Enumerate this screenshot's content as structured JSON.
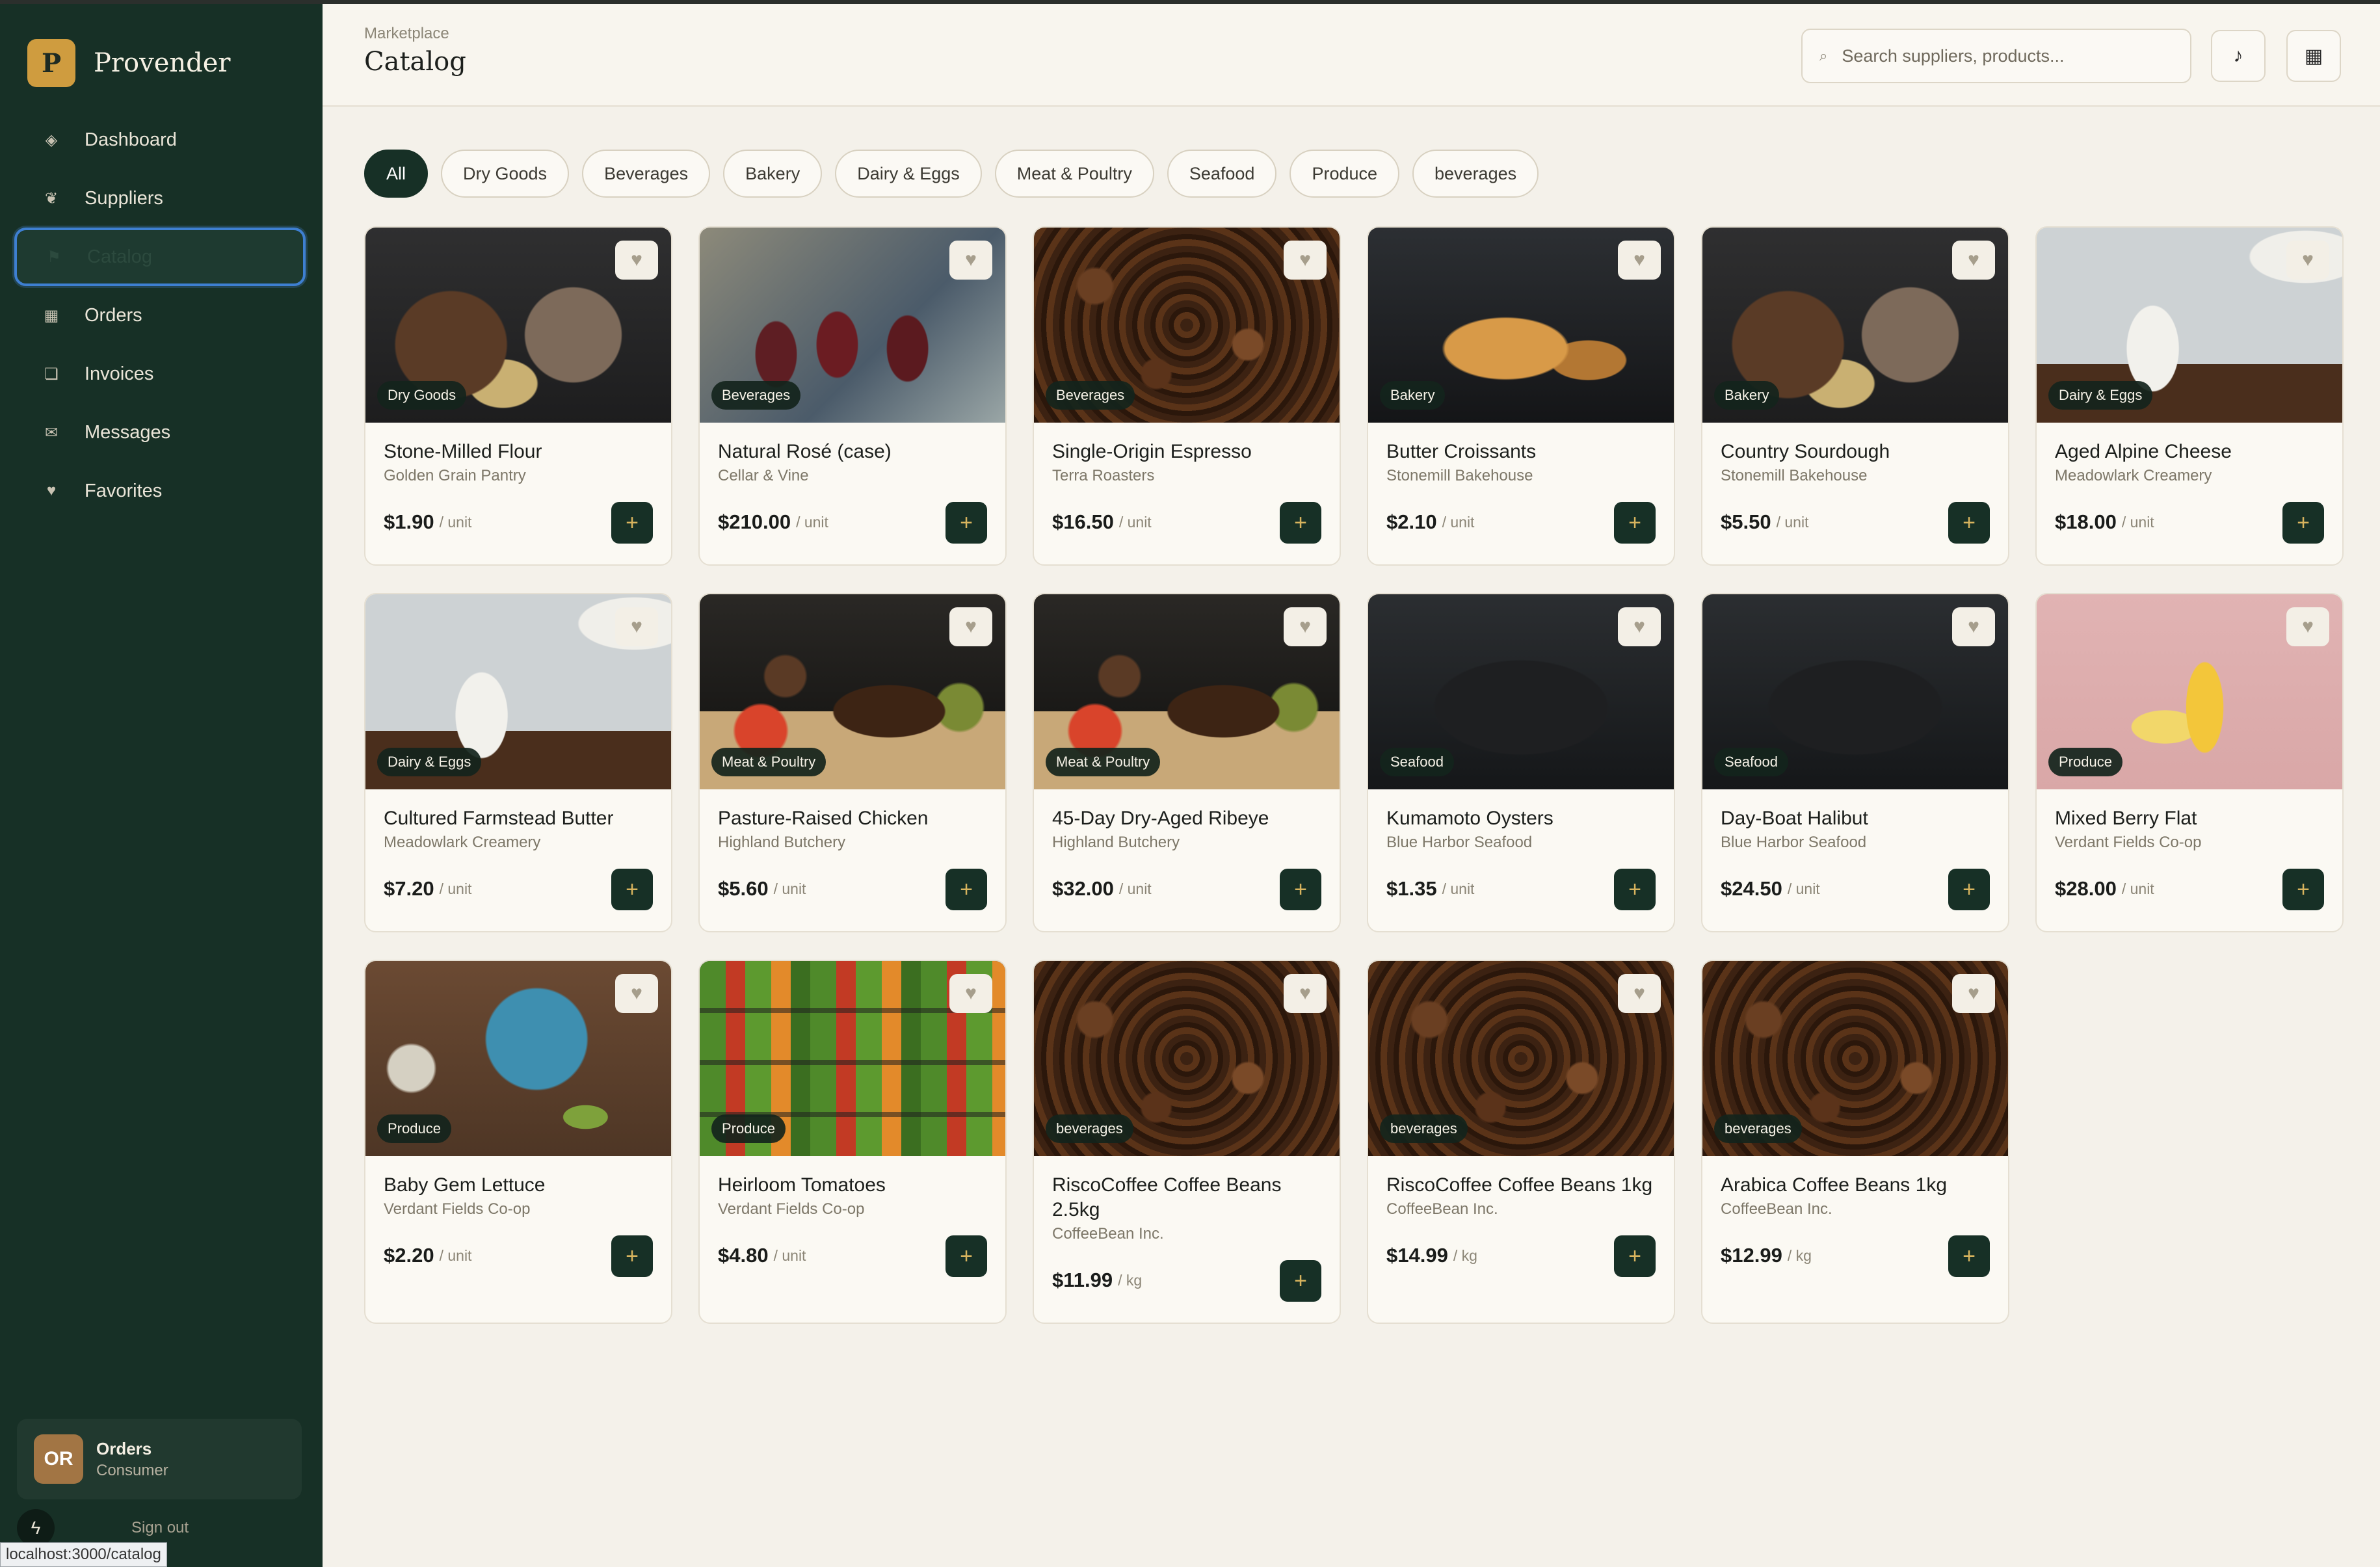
{
  "brand": {
    "logo_letter": "P",
    "name": "Provender"
  },
  "nav": [
    {
      "label": "Dashboard",
      "icon": "diamond-icon",
      "glyph": "◈"
    },
    {
      "label": "Suppliers",
      "icon": "apple-icon",
      "glyph": "❦"
    },
    {
      "label": "Catalog",
      "icon": "flag-icon",
      "glyph": "⚑",
      "active": true
    },
    {
      "label": "Orders",
      "icon": "box-icon",
      "glyph": "▦"
    },
    {
      "label": "Invoices",
      "icon": "document-icon",
      "glyph": "❏"
    },
    {
      "label": "Messages",
      "icon": "envelope-icon",
      "glyph": "✉"
    },
    {
      "label": "Favorites",
      "icon": "heart-icon",
      "glyph": "♥"
    }
  ],
  "account": {
    "initials": "OR",
    "name": "Orders",
    "role": "Consumer",
    "signout": "Sign out"
  },
  "status_url": "localhost:3000/catalog",
  "header": {
    "breadcrumb": "Marketplace",
    "title": "Catalog",
    "search_placeholder": "Search suppliers, products...",
    "search_icon_glyph": "⌕",
    "music_glyph": "♪",
    "grid_glyph": "▦"
  },
  "filters": [
    "All",
    "Dry Goods",
    "Beverages",
    "Bakery",
    "Dairy & Eggs",
    "Meat & Poultry",
    "Seafood",
    "Produce",
    "beverages"
  ],
  "active_filter": "All",
  "products": [
    {
      "name": "Stone-Milled Flour",
      "supplier": "Golden Grain Pantry",
      "price": "$1.90",
      "unit": "/ unit",
      "category": "Dry Goods",
      "image": "bread"
    },
    {
      "name": "Natural Rosé (case)",
      "supplier": "Cellar & Vine",
      "price": "$210.00",
      "unit": "/ unit",
      "category": "Beverages",
      "image": "wine"
    },
    {
      "name": "Single-Origin Espresso",
      "supplier": "Terra Roasters",
      "price": "$16.50",
      "unit": "/ unit",
      "category": "Beverages",
      "image": "coffee"
    },
    {
      "name": "Butter Croissants",
      "supplier": "Stonemill Bakehouse",
      "price": "$2.10",
      "unit": "/ unit",
      "category": "Bakery",
      "image": "croissant"
    },
    {
      "name": "Country Sourdough",
      "supplier": "Stonemill Bakehouse",
      "price": "$5.50",
      "unit": "/ unit",
      "category": "Bakery",
      "image": "bread"
    },
    {
      "name": "Aged Alpine Cheese",
      "supplier": "Meadowlark Creamery",
      "price": "$18.00",
      "unit": "/ unit",
      "category": "Dairy & Eggs",
      "image": "milk"
    },
    {
      "name": "Cultured Farmstead Butter",
      "supplier": "Meadowlark Creamery",
      "price": "$7.20",
      "unit": "/ unit",
      "category": "Dairy & Eggs",
      "image": "milk"
    },
    {
      "name": "Pasture-Raised Chicken",
      "supplier": "Highland Butchery",
      "price": "$5.60",
      "unit": "/ unit",
      "category": "Meat & Poultry",
      "image": "meat"
    },
    {
      "name": "45-Day Dry-Aged Ribeye",
      "supplier": "Highland Butchery",
      "price": "$32.00",
      "unit": "/ unit",
      "category": "Meat & Poultry",
      "image": "meat"
    },
    {
      "name": "Kumamoto Oysters",
      "supplier": "Blue Harbor Seafood",
      "price": "$1.35",
      "unit": "/ unit",
      "category": "Seafood",
      "image": "salmon"
    },
    {
      "name": "Day-Boat Halibut",
      "supplier": "Blue Harbor Seafood",
      "price": "$24.50",
      "unit": "/ unit",
      "category": "Seafood",
      "image": "salmon"
    },
    {
      "name": "Mixed Berry Flat",
      "supplier": "Verdant Fields Co-op",
      "price": "$28.00",
      "unit": "/ unit",
      "category": "Produce",
      "image": "banana"
    },
    {
      "name": "Baby Gem Lettuce",
      "supplier": "Verdant Fields Co-op",
      "price": "$2.20",
      "unit": "/ unit",
      "category": "Produce",
      "image": "salad"
    },
    {
      "name": "Heirloom Tomatoes",
      "supplier": "Verdant Fields Co-op",
      "price": "$4.80",
      "unit": "/ unit",
      "category": "Produce",
      "image": "market"
    },
    {
      "name": "RiscoCoffee Coffee Beans 2.5kg",
      "supplier": "CoffeeBean Inc.",
      "price": "$11.99",
      "unit": "/ kg",
      "category": "beverages",
      "image": "coffee"
    },
    {
      "name": "RiscoCoffee Coffee Beans 1kg",
      "supplier": "CoffeeBean Inc.",
      "price": "$14.99",
      "unit": "/ kg",
      "category": "beverages",
      "image": "coffee"
    },
    {
      "name": "Arabica Coffee Beans 1kg",
      "supplier": "CoffeeBean Inc.",
      "price": "$12.99",
      "unit": "/ kg",
      "category": "beverages",
      "image": "coffee"
    }
  ],
  "icons": {
    "favorite": "heart-icon",
    "add": "plus-icon",
    "favorite_glyph": "♥",
    "add_glyph": "+"
  },
  "colors": {
    "sidebar": "#173026",
    "accent": "#cf9c3f",
    "focus_ring": "#3e7fd1",
    "add_plus": "#d8b45e"
  }
}
